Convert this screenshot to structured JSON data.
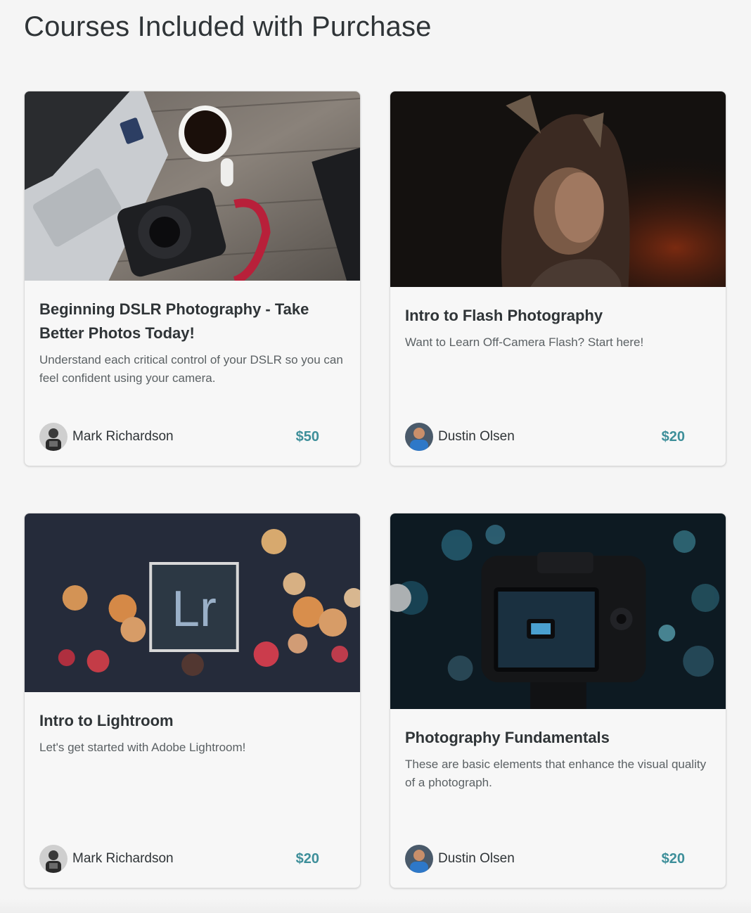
{
  "page": {
    "heading": "Courses Included with Purchase"
  },
  "courses": [
    {
      "title": "Beginning DSLR Photography - Take Better Photos Today!",
      "description": "Understand each critical control of your DSLR so you can feel confident using your camera.",
      "author": "Mark Richardson",
      "price": "$50",
      "image": "dslr-desk-photo"
    },
    {
      "title": "Intro to Flash Photography",
      "description": "Want to Learn Off-Camera Flash? Start here!",
      "author": "Dustin Olsen",
      "price": "$20",
      "image": "child-hood-portrait-photo"
    },
    {
      "title": "Intro to Lightroom",
      "description": "Let's get started with Adobe Lightroom!",
      "author": "Mark Richardson",
      "price": "$20",
      "image": "lightroom-logo-bokeh-photo",
      "logo_text": "Lr"
    },
    {
      "title": "Photography Fundamentals",
      "description": "These are basic elements that enhance the visual quality of a photograph.",
      "author": "Dustin Olsen",
      "price": "$20",
      "image": "camera-back-screen-photo"
    }
  ],
  "colors": {
    "price": "#3e8f9a",
    "text": "#2f3437",
    "background": "#f5f5f5"
  }
}
